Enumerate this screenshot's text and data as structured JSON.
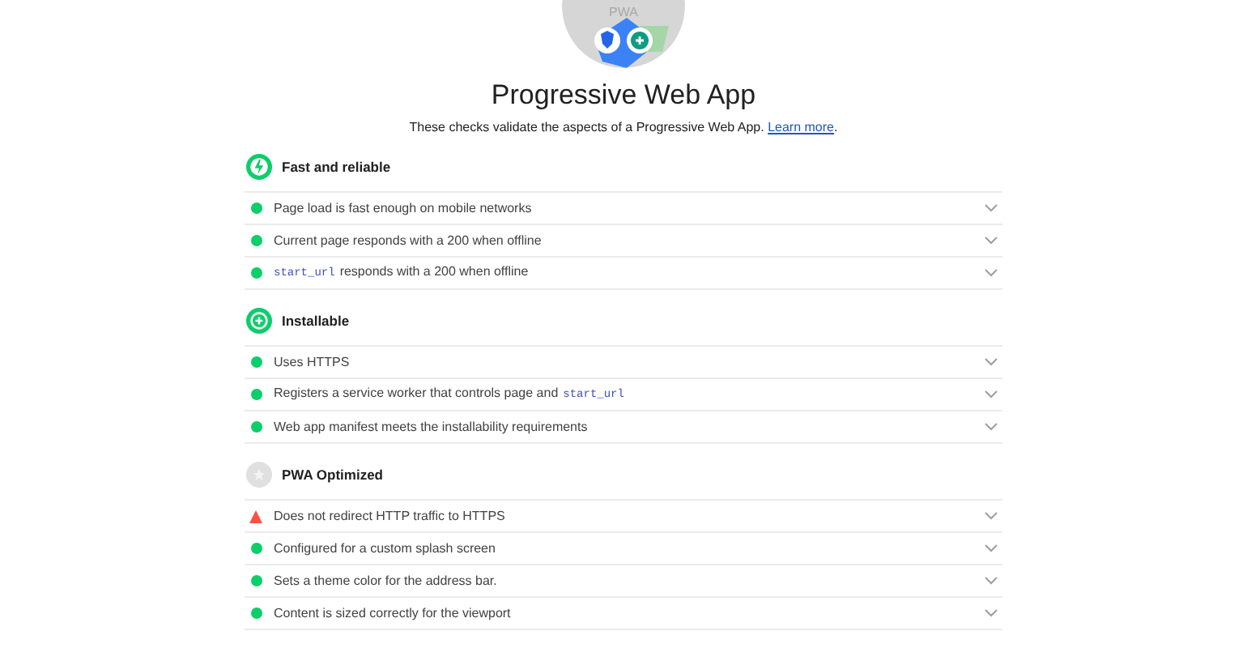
{
  "logo": {
    "text": "PWA"
  },
  "title": "Progressive Web App",
  "description": {
    "text": "These checks validate the aspects of a Progressive Web App.",
    "link": "Learn more",
    "after": "."
  },
  "sections": [
    {
      "title": "Fast and reliable",
      "kind": "bolt",
      "audits": [
        {
          "kind": "pass",
          "parts": [
            {
              "kind": "text",
              "text": "Page load is fast enough on mobile networks"
            }
          ]
        },
        {
          "kind": "pass",
          "parts": [
            {
              "kind": "text",
              "text": "Current page responds with a 200 when offline"
            }
          ]
        },
        {
          "kind": "pass",
          "parts": [
            {
              "kind": "code",
              "text": "start_url"
            },
            {
              "kind": "text",
              "text": "responds with a 200 when offline"
            }
          ]
        }
      ]
    },
    {
      "title": "Installable",
      "kind": "plus",
      "audits": [
        {
          "kind": "pass",
          "parts": [
            {
              "kind": "text",
              "text": "Uses HTTPS"
            }
          ]
        },
        {
          "kind": "pass",
          "parts": [
            {
              "kind": "text",
              "text": "Registers a service worker that controls page and"
            },
            {
              "kind": "code",
              "text": "start_url"
            }
          ]
        },
        {
          "kind": "pass",
          "parts": [
            {
              "kind": "text",
              "text": "Web app manifest meets the installability requirements"
            }
          ]
        }
      ]
    },
    {
      "title": "PWA Optimized",
      "kind": "star",
      "audits": [
        {
          "kind": "fail",
          "parts": [
            {
              "kind": "text",
              "text": "Does not redirect HTTP traffic to HTTPS"
            }
          ]
        },
        {
          "kind": "pass",
          "parts": [
            {
              "kind": "text",
              "text": "Configured for a custom splash screen"
            }
          ]
        },
        {
          "kind": "pass",
          "parts": [
            {
              "kind": "text",
              "text": "Sets a theme color for the address bar."
            }
          ]
        },
        {
          "kind": "pass",
          "parts": [
            {
              "kind": "text",
              "text": "Content is sized correctly for the viewport"
            }
          ]
        }
      ]
    }
  ]
}
